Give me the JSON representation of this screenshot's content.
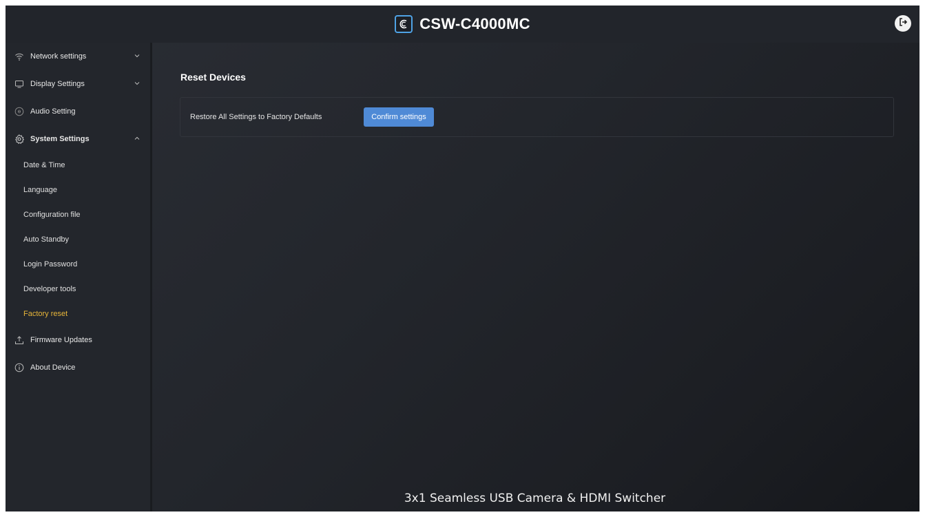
{
  "header": {
    "title": "CSW-C4000MC",
    "logo_icon": "brand-c-icon",
    "logout_icon": "logout-icon"
  },
  "sidebar": {
    "items": [
      {
        "label": "Network settings",
        "icon": "wifi-icon",
        "expanded": false
      },
      {
        "label": "Display Settings",
        "icon": "monitor-icon",
        "expanded": false
      },
      {
        "label": "Audio Setting",
        "icon": "audio-icon"
      },
      {
        "label": "System Settings",
        "icon": "gear-icon",
        "expanded": true
      },
      {
        "label": "Firmware Updates",
        "icon": "upload-icon"
      },
      {
        "label": "About Device",
        "icon": "info-icon"
      }
    ],
    "system_sub": [
      {
        "label": "Date & Time"
      },
      {
        "label": "Language"
      },
      {
        "label": "Configuration file"
      },
      {
        "label": "Auto Standby"
      },
      {
        "label": "Login Password"
      },
      {
        "label": "Developer tools"
      },
      {
        "label": "Factory reset",
        "active": true
      }
    ]
  },
  "main": {
    "title": "Reset Devices",
    "reset_label": "Restore All Settings to Factory Defaults",
    "confirm_button": "Confirm settings"
  },
  "footer": {
    "text": "3x1 Seamless USB Camera & HDMI Switcher"
  },
  "colors": {
    "accent_blue": "#4f8ad6",
    "active_item": "#e8b63a",
    "background": "#23262c"
  }
}
